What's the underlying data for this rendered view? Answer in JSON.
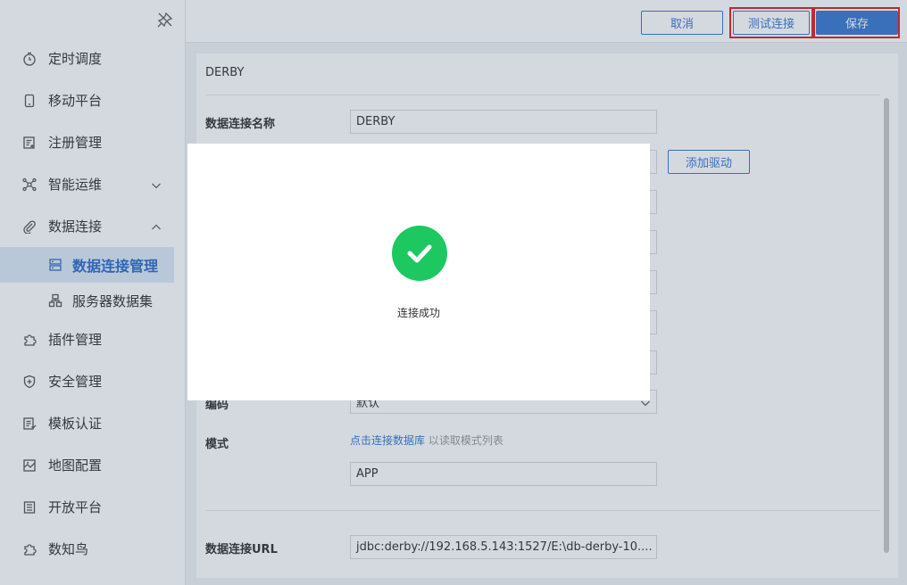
{
  "sidebar": {
    "items": [
      {
        "label": "定时调度",
        "icon": "clock-icon"
      },
      {
        "label": "移动平台",
        "icon": "phone-icon"
      },
      {
        "label": "注册管理",
        "icon": "register-icon"
      },
      {
        "label": "智能运维",
        "icon": "ops-icon",
        "expanded": false
      },
      {
        "label": "数据连接",
        "icon": "link-icon",
        "expanded": true
      },
      {
        "label": "插件管理",
        "icon": "plugin-icon"
      },
      {
        "label": "安全管理",
        "icon": "shield-icon"
      },
      {
        "label": "模板认证",
        "icon": "template-icon"
      },
      {
        "label": "地图配置",
        "icon": "map-icon"
      },
      {
        "label": "开放平台",
        "icon": "open-platform-icon"
      },
      {
        "label": "数知鸟",
        "icon": "bird-icon"
      }
    ],
    "subitems": [
      {
        "label": "数据连接管理",
        "icon": "database-icon",
        "active": true
      },
      {
        "label": "服务器数据集",
        "icon": "server-dataset-icon",
        "active": false
      }
    ]
  },
  "toolbar": {
    "cancel_label": "取消",
    "test_label": "测试连接",
    "save_label": "保存"
  },
  "form": {
    "title": "DERBY",
    "name_label": "数据连接名称",
    "name_value": "DERBY",
    "add_driver_label": "添加驱动",
    "encoding_label": "编码",
    "encoding_value": "默认",
    "schema_label": "模式",
    "schema_link": "点击连接数据库",
    "schema_hint": "以读取模式列表",
    "schema_value": "APP",
    "url_label": "数据连接URL",
    "url_value": "jdbc:derby://192.168.5.143:1527/E:\\db-derby-10...."
  },
  "modal": {
    "message": "连接成功",
    "icon": "success-check-icon"
  },
  "colors": {
    "accent": "#3a78d0",
    "success": "#1dc861",
    "highlight": "#e02020"
  }
}
